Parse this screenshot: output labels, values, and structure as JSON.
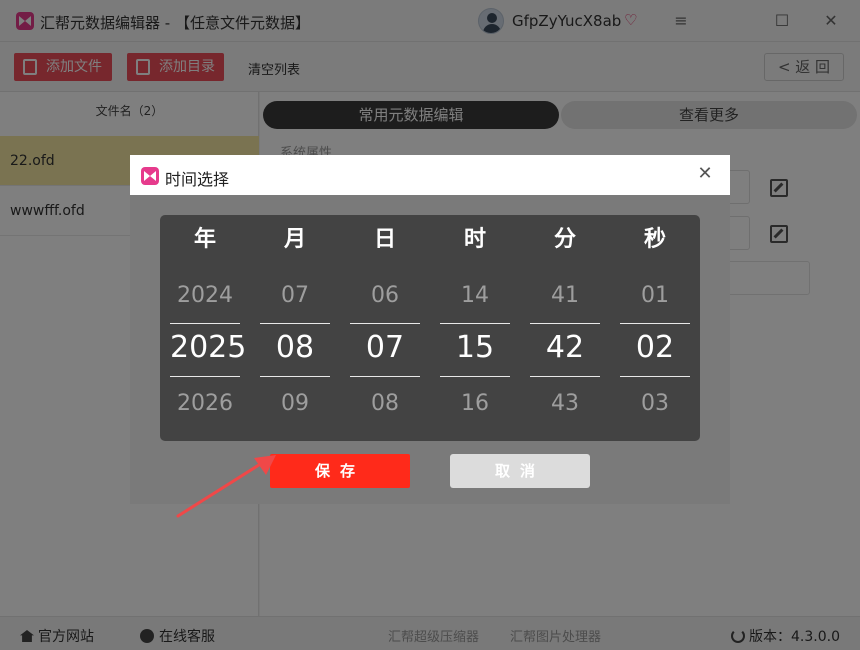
{
  "window": {
    "title": "汇帮元数据编辑器 - 【任意文件元数据】",
    "user_name": "GfpZyYucX8ab",
    "controls": {
      "menu": "≡",
      "maximize": "☐",
      "close": "✕"
    }
  },
  "toolbar": {
    "add_file": "添加文件",
    "add_folder": "添加目录",
    "clear_list": "清空列表",
    "back": "< 返 回"
  },
  "file_list": {
    "header": "文件名（2）",
    "files": [
      "22.ofd",
      "wwwfff.ofd"
    ],
    "selected": "22.ofd"
  },
  "content": {
    "tabs": [
      "常用元数据编辑",
      "查看更多"
    ],
    "active_tab": "常用元数据编辑",
    "section_label": "系统属性"
  },
  "dialog": {
    "title": "时间选择",
    "close": "✕",
    "columns": [
      {
        "label": "年",
        "prev": "2024",
        "current": "2025",
        "next": "2026"
      },
      {
        "label": "月",
        "prev": "07",
        "current": "08",
        "next": "09"
      },
      {
        "label": "日",
        "prev": "06",
        "current": "07",
        "next": "08"
      },
      {
        "label": "时",
        "prev": "14",
        "current": "15",
        "next": "16"
      },
      {
        "label": "分",
        "prev": "41",
        "current": "42",
        "next": "43"
      },
      {
        "label": "秒",
        "prev": "01",
        "current": "02",
        "next": "03"
      }
    ],
    "save": "保存",
    "cancel": "取消"
  },
  "footer": {
    "website": "官方网站",
    "support": "在线客服",
    "compressor": "汇帮超级压缩器",
    "image_tool": "汇帮图片处理器",
    "version": "版本：4.3.0.0"
  },
  "colors": {
    "accent_red": "#ee4e5a",
    "save_red": "#ff2a1a",
    "selected_row": "#f4e7a2",
    "picker_bg": "#434343",
    "arrow": "#f04848"
  }
}
